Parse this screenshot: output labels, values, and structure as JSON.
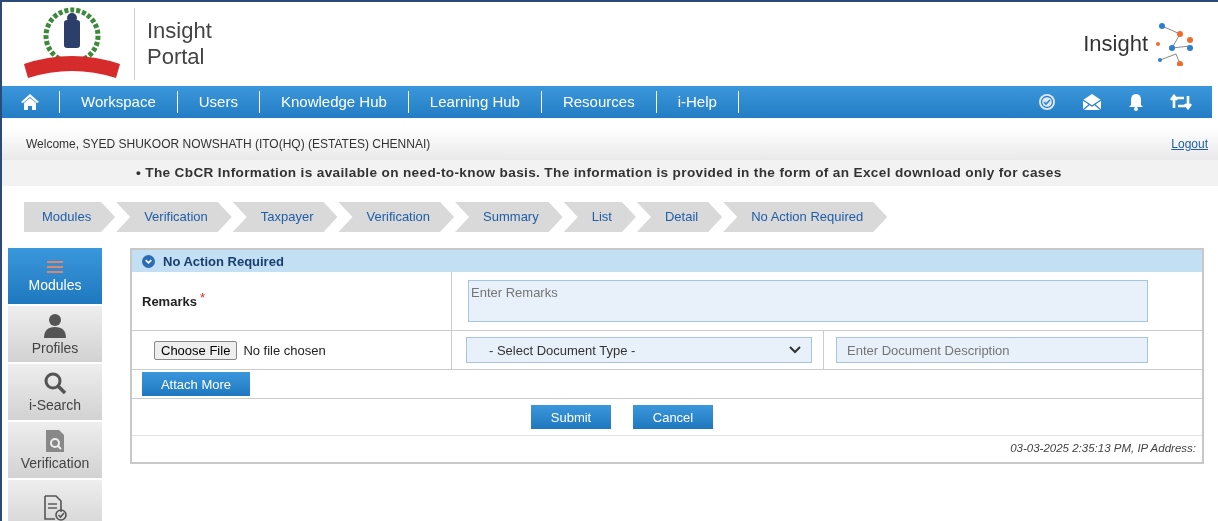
{
  "header": {
    "title_lines": [
      "Insight",
      "Portal"
    ],
    "brand": "Insight"
  },
  "nav": {
    "items": [
      {
        "label": "Workspace"
      },
      {
        "label": "Users"
      },
      {
        "label": "Knowledge Hub"
      },
      {
        "label": "Learning Hub"
      },
      {
        "label": "Resources"
      },
      {
        "label": "i-Help"
      }
    ]
  },
  "welcome": "Welcome, SYED SHUKOOR NOWSHATH (ITO(HQ) (ESTATES) CHENNAI)",
  "logout": "Logout",
  "notice": "• The CbCR Information is available on need-to-know basis. The information is provided in the form of an Excel download only for cases",
  "breadcrumb": [
    "Modules",
    "Verification",
    "Taxpayer",
    "Verification",
    "Summary",
    "List",
    "Detail",
    "No Action Required"
  ],
  "sidebar": [
    {
      "kind": "menu",
      "label": "Modules",
      "selected": true
    },
    {
      "kind": "person",
      "label": "Profiles",
      "selected": false
    },
    {
      "kind": "search",
      "label": "i-Search",
      "selected": false
    },
    {
      "kind": "doc-search",
      "label": "Verification",
      "selected": false
    },
    {
      "kind": "doc-check",
      "selected": false
    }
  ],
  "form": {
    "title": "No Action Required",
    "expanded": true,
    "remarks_label": "Remarks",
    "required_mark": "*",
    "remarks_placeholder": "Enter Remarks",
    "file_button": "Choose File",
    "file_status": "No file chosen",
    "doc_type": "- Select Document Type -",
    "doc_desc_placeholder": "Enter Document Description",
    "attach_button": "Attach More",
    "buttons": [
      "Submit",
      "Cancel"
    ],
    "footer": "03-03-2025 2:35:13 PM, IP Address:"
  }
}
